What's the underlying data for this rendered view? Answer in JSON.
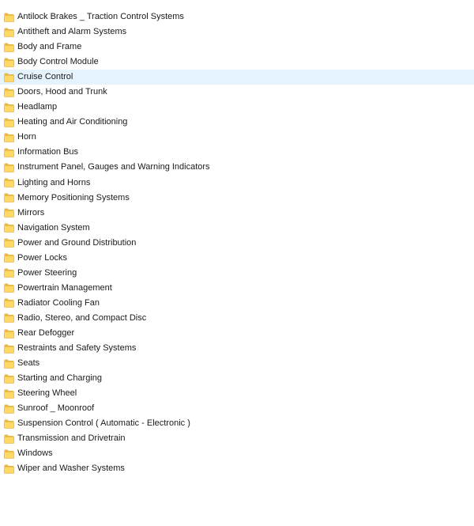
{
  "folders": {
    "items": [
      {
        "label": "Antilock Brakes _ Traction Control Systems",
        "icon": "folder-icon"
      },
      {
        "label": "Antitheft and Alarm Systems",
        "icon": "folder-icon"
      },
      {
        "label": "Body and Frame",
        "icon": "folder-icon"
      },
      {
        "label": "Body Control Module",
        "icon": "folder-icon"
      },
      {
        "label": "Cruise Control",
        "icon": "folder-icon",
        "state": "hovered"
      },
      {
        "label": "Doors, Hood and Trunk",
        "icon": "folder-icon"
      },
      {
        "label": "Headlamp",
        "icon": "folder-icon"
      },
      {
        "label": "Heating and Air Conditioning",
        "icon": "folder-icon"
      },
      {
        "label": "Horn",
        "icon": "folder-icon"
      },
      {
        "label": "Information Bus",
        "icon": "folder-icon"
      },
      {
        "label": "Instrument Panel, Gauges and Warning Indicators",
        "icon": "folder-icon"
      },
      {
        "label": "Lighting and Horns",
        "icon": "folder-icon"
      },
      {
        "label": "Memory Positioning Systems",
        "icon": "folder-icon"
      },
      {
        "label": "Mirrors",
        "icon": "folder-icon"
      },
      {
        "label": "Navigation System",
        "icon": "folder-icon"
      },
      {
        "label": "Power and Ground Distribution",
        "icon": "folder-icon"
      },
      {
        "label": "Power Locks",
        "icon": "folder-icon"
      },
      {
        "label": "Power Steering",
        "icon": "folder-icon"
      },
      {
        "label": "Powertrain Management",
        "icon": "folder-icon"
      },
      {
        "label": "Radiator Cooling Fan",
        "icon": "folder-icon"
      },
      {
        "label": "Radio, Stereo, and Compact Disc",
        "icon": "folder-icon"
      },
      {
        "label": "Rear Defogger",
        "icon": "folder-icon"
      },
      {
        "label": "Restraints and Safety Systems",
        "icon": "folder-icon"
      },
      {
        "label": "Seats",
        "icon": "folder-icon"
      },
      {
        "label": "Starting and Charging",
        "icon": "folder-icon"
      },
      {
        "label": "Steering Wheel",
        "icon": "folder-icon"
      },
      {
        "label": "Sunroof _ Moonroof",
        "icon": "folder-icon"
      },
      {
        "label": "Suspension Control ( Automatic - Electronic )",
        "icon": "folder-icon"
      },
      {
        "label": "Transmission and Drivetrain",
        "icon": "folder-icon"
      },
      {
        "label": "Windows",
        "icon": "folder-icon"
      },
      {
        "label": "Wiper and Washer Systems",
        "icon": "folder-icon"
      }
    ]
  },
  "colors": {
    "folder_body": "#ffd866",
    "folder_back": "#e8b94a",
    "folder_edge": "#d9a636",
    "hover_background": "#e5f3ff",
    "text": "#1a1a1a"
  }
}
